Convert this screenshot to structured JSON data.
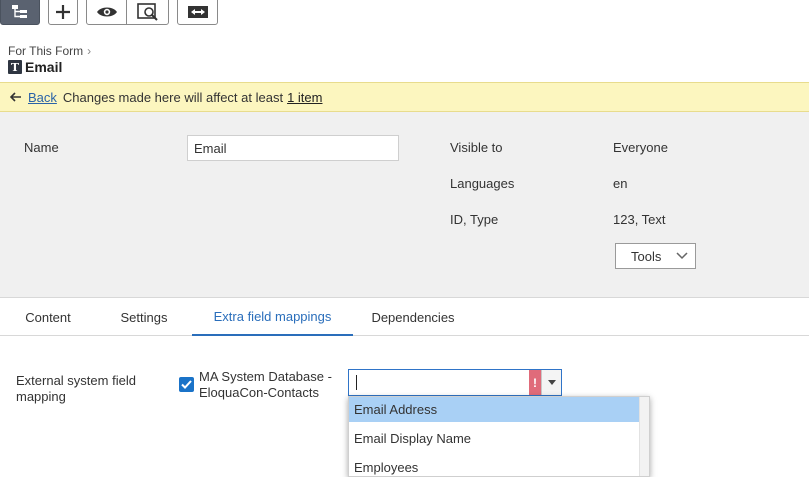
{
  "toolbar": {
    "buttons": [
      {
        "icon": "tree-icon",
        "active": true
      },
      {
        "icon": "plus-icon"
      },
      {
        "icon": "eye-icon"
      },
      {
        "icon": "preview-icon"
      },
      {
        "icon": "swap-icon"
      }
    ]
  },
  "breadcrumb": {
    "parent": "For This Form",
    "separator": "›"
  },
  "title": {
    "icon_letter": "T",
    "text": "Email"
  },
  "banner": {
    "back_label": "Back",
    "message": "Changes made here will affect at least",
    "link_text": "1 item"
  },
  "properties": {
    "name_label": "Name",
    "name_value": "Email",
    "visible_to_label": "Visible to",
    "visible_to_value": "Everyone",
    "languages_label": "Languages",
    "languages_value": "en",
    "id_type_label": "ID, Type",
    "id_type_value": "123, Text",
    "tools_label": "Tools"
  },
  "tabs": [
    {
      "label": "Content"
    },
    {
      "label": "Settings"
    },
    {
      "label": "Extra field mappings",
      "active": true
    },
    {
      "label": "Dependencies"
    }
  ],
  "mapping": {
    "label": "External system field mapping",
    "checked": true,
    "db_label": "MA System Database - EloquaCon-Contacts",
    "input_value": "",
    "error_marker": "!",
    "options": [
      "Email Address",
      "Email Display Name",
      "Employees"
    ],
    "highlighted_option": "Email Address"
  },
  "colors": {
    "accent": "#2a6ebb",
    "banner_bg": "#fcf6bf",
    "panel_bg": "#f0f0f0",
    "error": "#e06b7a",
    "highlight": "#a9d0f5"
  }
}
